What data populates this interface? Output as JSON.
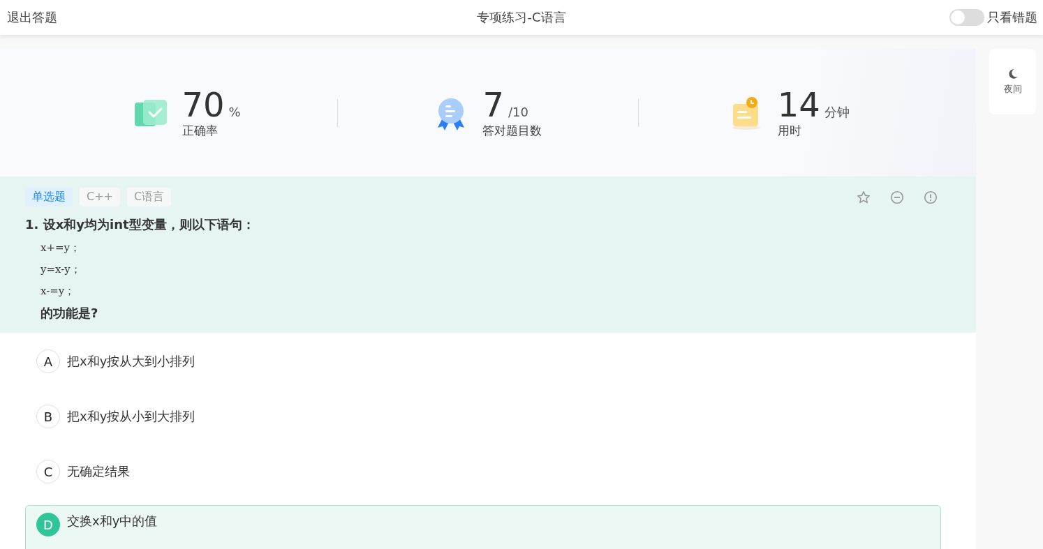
{
  "header": {
    "exit": "退出答题",
    "title": "专项练习-C语言",
    "toggle": {
      "label": "只看错题",
      "on": false
    }
  },
  "stats": [
    {
      "kind": "accuracy",
      "value": "70",
      "unit": "%",
      "label": "正确率"
    },
    {
      "kind": "correct",
      "value": "7",
      "unit": "/10",
      "label": "答对题目数"
    },
    {
      "kind": "time",
      "value": "14",
      "unit": "分钟",
      "label": "用时"
    }
  ],
  "question": {
    "tags": [
      {
        "label": "单选题",
        "kind": "type"
      },
      {
        "label": "C++",
        "kind": "topic"
      },
      {
        "label": "C语言",
        "kind": "topic"
      }
    ],
    "title": "1. 设x和y均为int型变量，则以下语句：",
    "code": [
      "x+=y；",
      "y=x-y；",
      "x-=y；"
    ],
    "ending": "的功能是?"
  },
  "options": [
    {
      "letter": "A",
      "text": "把x和y按从大到小排列",
      "selected": false
    },
    {
      "letter": "B",
      "text": "把x和y按从小到大排列",
      "selected": false
    },
    {
      "letter": "C",
      "text": "无确定结果",
      "selected": false
    },
    {
      "letter": "D",
      "text": "交换x和y中的值",
      "selected": true
    }
  ],
  "night": {
    "label": "夜间"
  }
}
